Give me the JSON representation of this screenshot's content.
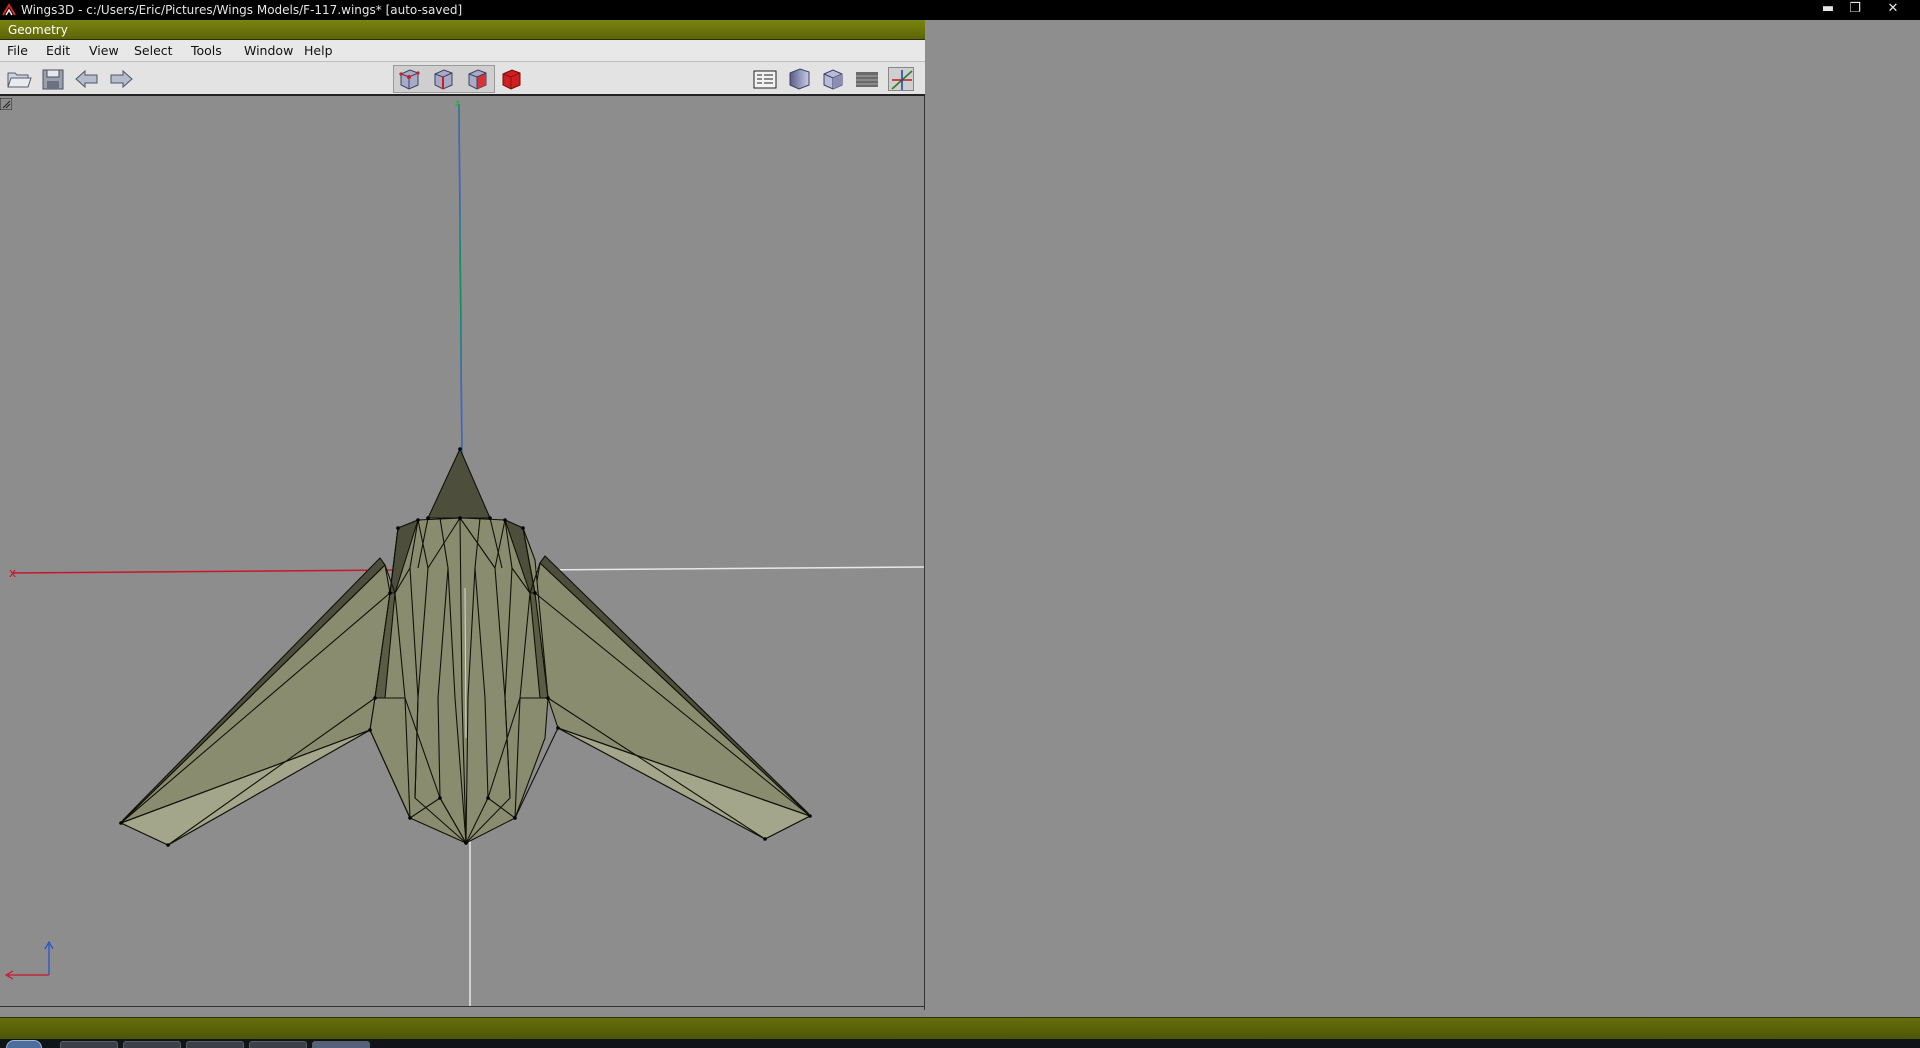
{
  "window": {
    "title": "Wings3D - c:/Users/Eric/Pictures/Wings Models/F-117.wings* [auto-saved]",
    "app_icon": "wings3d-logo-icon",
    "controls": [
      {
        "name": "minimize-button",
        "glyph": "▬"
      },
      {
        "name": "restore-button",
        "glyph": "❐"
      },
      {
        "name": "close-button",
        "glyph": "✕"
      }
    ]
  },
  "geometry": {
    "title": "Geometry",
    "menu": [
      "File",
      "Edit",
      "View",
      "Select",
      "Tools",
      "Window",
      "Help"
    ],
    "toolbar": {
      "left": [
        {
          "name": "open-folder-icon"
        },
        {
          "name": "save-disk-icon"
        },
        {
          "name": "undo-arrow-icon"
        },
        {
          "name": "redo-arrow-icon"
        }
      ],
      "modes": [
        {
          "name": "vertex-mode-icon"
        },
        {
          "name": "edge-mode-icon"
        },
        {
          "name": "face-mode-icon"
        },
        {
          "name": "body-mode-icon"
        }
      ],
      "right": [
        {
          "name": "groundplane-icon"
        },
        {
          "name": "smooth-shading-icon"
        },
        {
          "name": "orthographic-cube-icon"
        },
        {
          "name": "wireframe-icon"
        },
        {
          "name": "show-axes-icon"
        }
      ]
    },
    "viewport": {
      "axis_x_label": "x",
      "axis_z_label": "z",
      "model": "F-117 mesh",
      "colors": {
        "background": "#8d8d8d",
        "mesh_face": "#8a8c70",
        "mesh_face_light": "#a3a68a",
        "mesh_face_dark": "#4d4f3c",
        "x_axis": "#c8162b",
        "y_axis": "#17b81f",
        "z_axis": "#1b4fd6"
      }
    }
  },
  "colors": {
    "status_bar": "#5c6508",
    "title_bar": "#000000"
  }
}
